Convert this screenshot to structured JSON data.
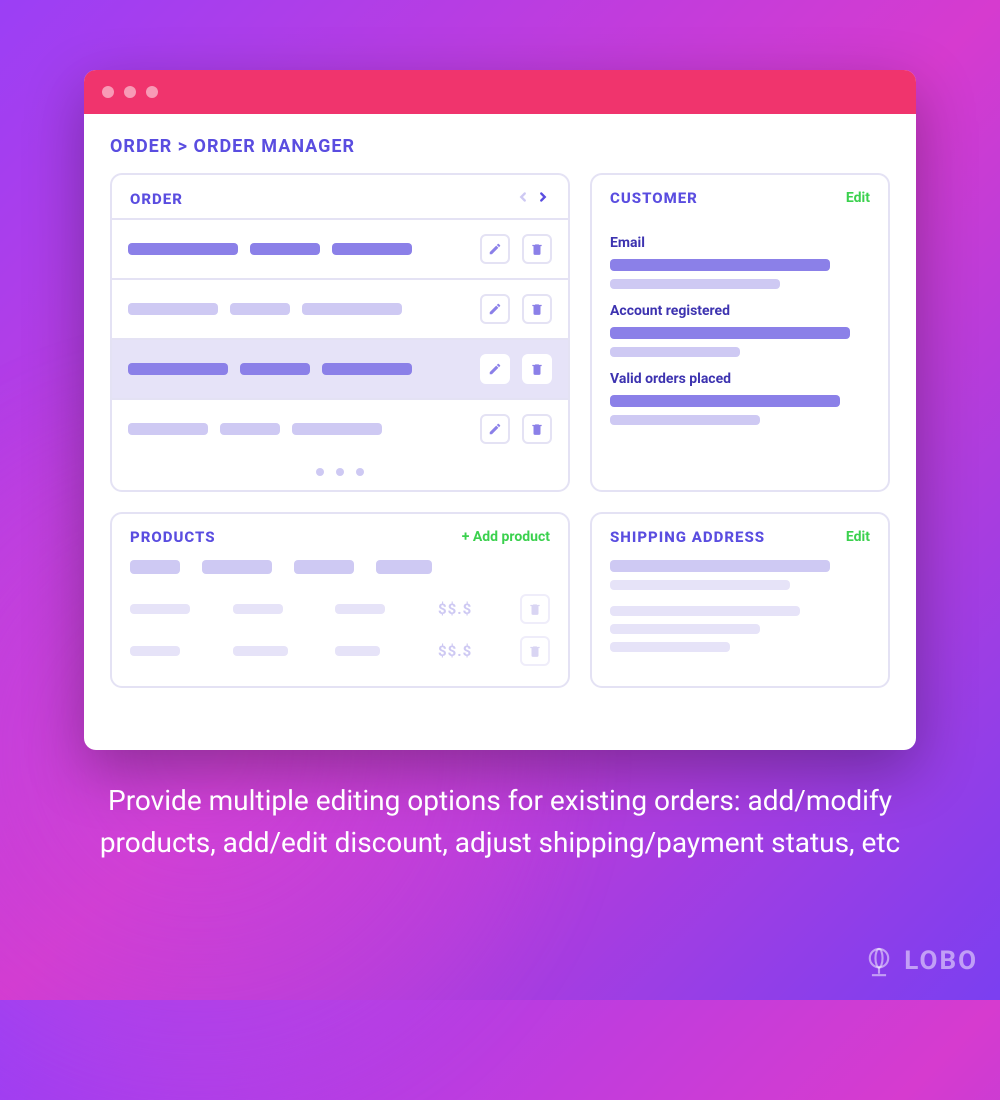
{
  "breadcrumb": "ORDER > ORDER MANAGER",
  "order": {
    "title": "ORDER"
  },
  "customer": {
    "title": "CUSTOMER",
    "edit_label": "Edit",
    "section_email": "Email",
    "section_account": "Account registered",
    "section_valid": "Valid orders placed"
  },
  "products": {
    "title": "PRODUCTS",
    "add_label": "+ Add product",
    "price_placeholder": "$$.$"
  },
  "shipping": {
    "title": "SHIPPING ADDRESS",
    "edit_label": "Edit"
  },
  "caption": "Provide multiple editing options for existing orders: add/modify products, add/edit discount, adjust shipping/payment status, etc",
  "logo": "LOBO"
}
